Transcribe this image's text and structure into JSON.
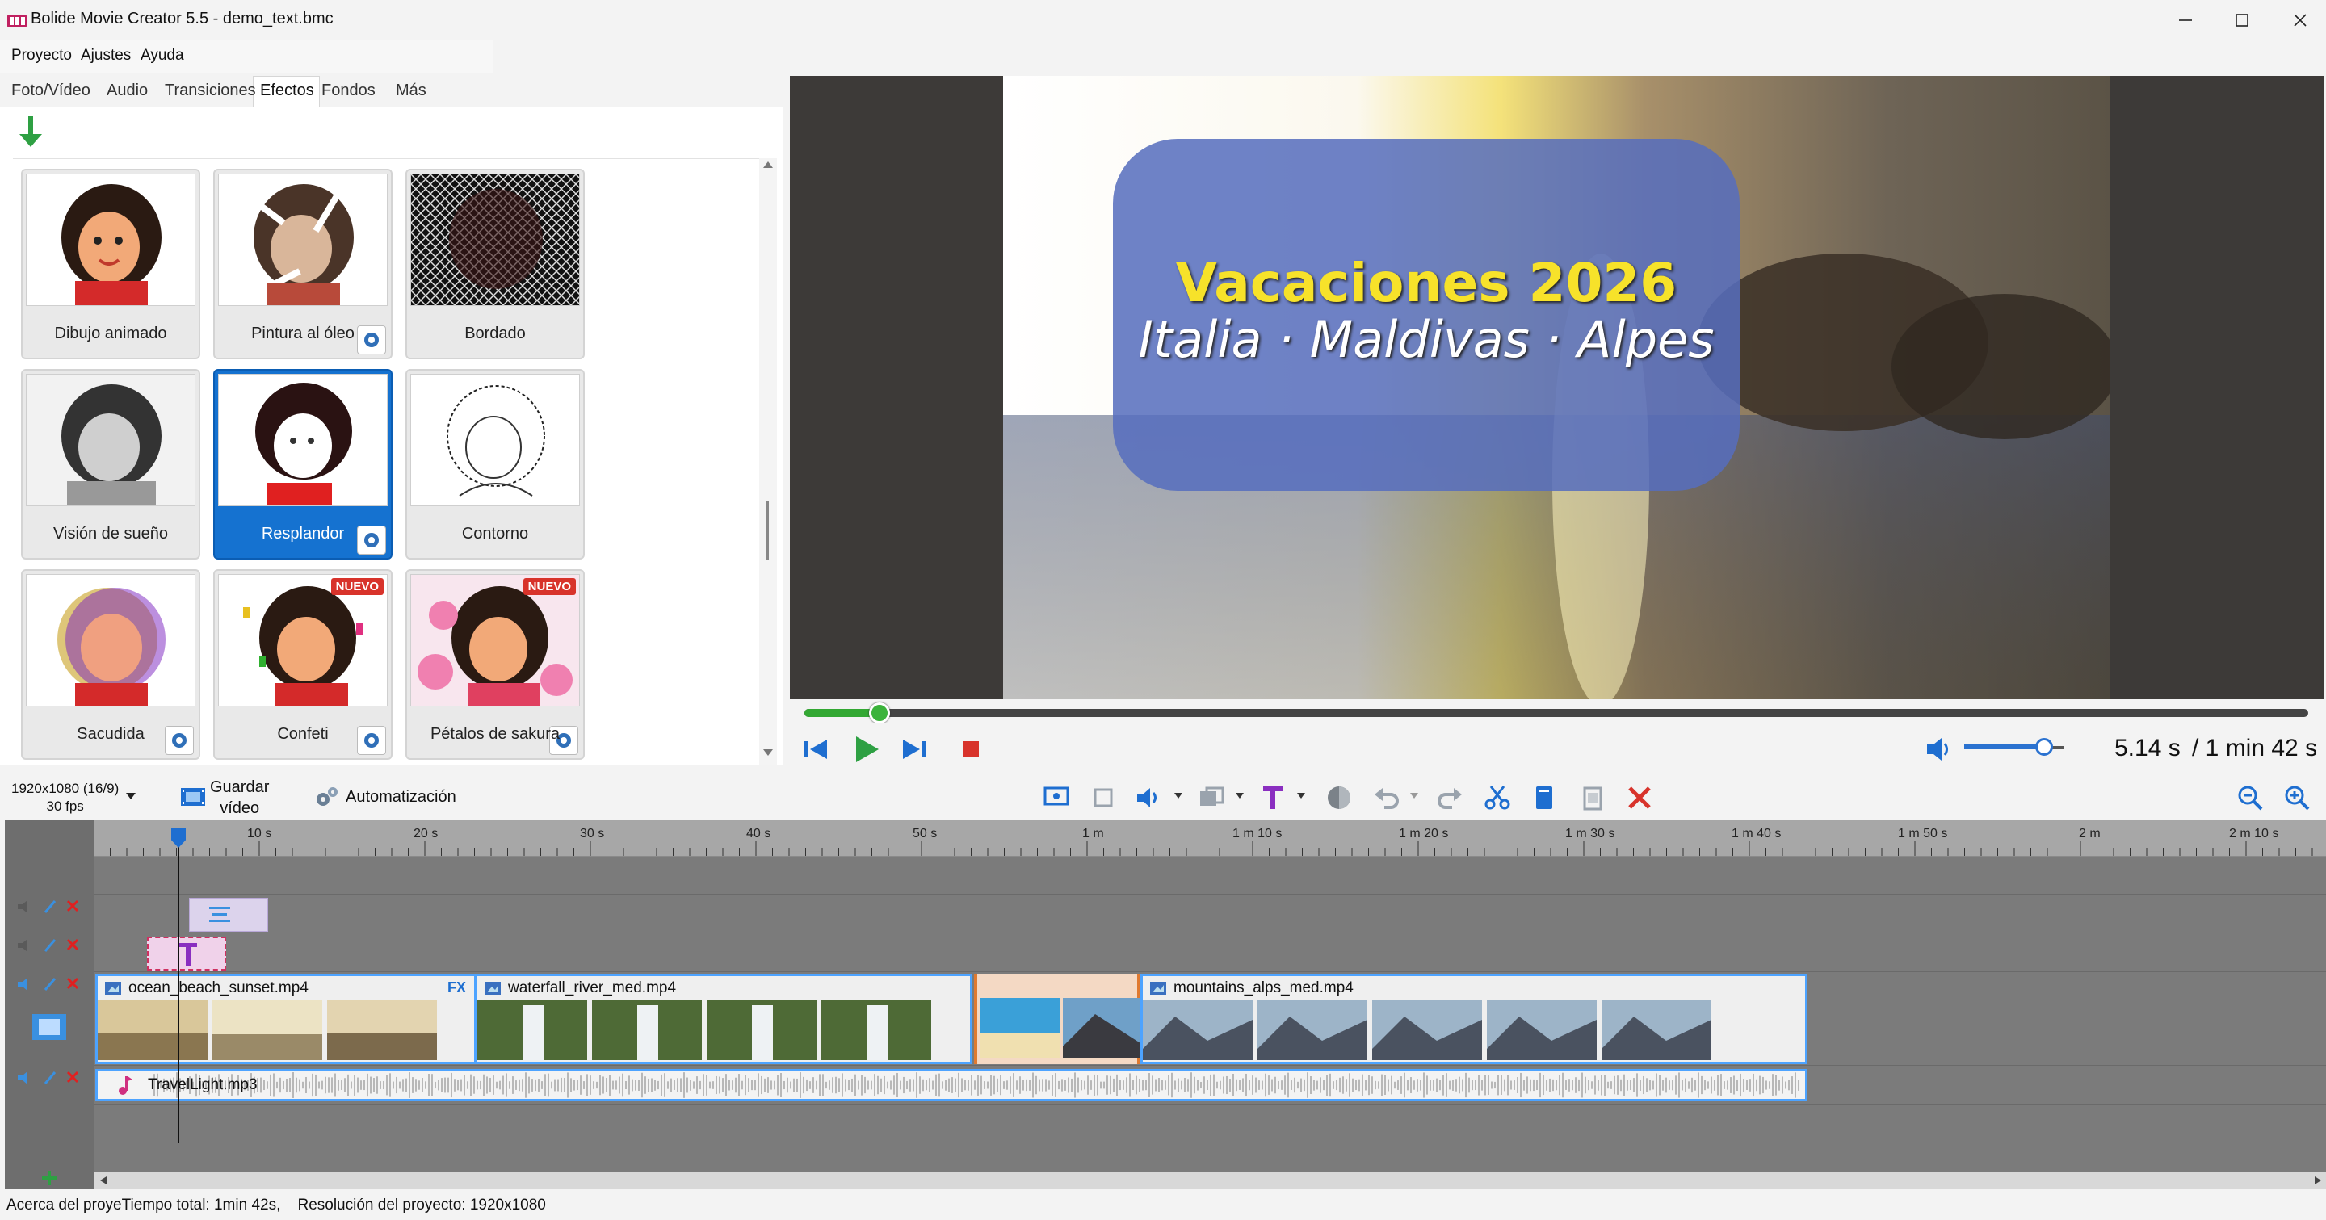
{
  "window": {
    "title": "Bolide Movie Creator 5.5 - demo_text.bmc",
    "controls": [
      "minimize",
      "maximize",
      "close"
    ]
  },
  "menu": [
    "Proyecto",
    "Ajustes",
    "Ayuda"
  ],
  "tabs": [
    "Foto/Vídeo",
    "Audio",
    "Transiciones",
    "Efectos",
    "Fondos",
    "Más"
  ],
  "active_tab": "Efectos",
  "effects": [
    {
      "label": "Dibujo animado",
      "gear": false,
      "new": false
    },
    {
      "label": "Pintura al óleo",
      "gear": true,
      "new": false
    },
    {
      "label": "Bordado",
      "gear": false,
      "new": false
    },
    {
      "label": "Visión de sueño",
      "gear": false,
      "new": false
    },
    {
      "label": "Resplandor",
      "gear": true,
      "new": false,
      "selected": true
    },
    {
      "label": "Contorno",
      "gear": false,
      "new": false
    },
    {
      "label": "Sacudida",
      "gear": true,
      "new": false
    },
    {
      "label": "Confeti",
      "gear": true,
      "new": true
    },
    {
      "label": "Pétalos de sakura",
      "gear": true,
      "new": true
    }
  ],
  "new_badge": "NUEVO",
  "preview": {
    "title_line1": "Vacaciones 2026",
    "title_line2": "Italia · Maldivas · Alpes",
    "progress": 0.05
  },
  "transport": {
    "time_current": "5.14 s",
    "time_total": "/ 1 min 42 s",
    "volume": 0.8
  },
  "toolbar": {
    "resolution_line1": "1920x1080 (16/9)",
    "resolution_line2": "30 fps",
    "save_video_line1": "Guardar",
    "save_video_line2": "vídeo",
    "automation": "Automatización"
  },
  "timeline": {
    "ruler_labels": [
      "10 s",
      "20 s",
      "30 s",
      "40 s",
      "50 s",
      "1 m",
      "1 m 10 s",
      "1 m 20 s",
      "1 m 30 s",
      "1 m 40 s",
      "1 m 50 s",
      "2 m",
      "2 m 10 s"
    ],
    "clips": {
      "ocean": "ocean_beach_sunset.mp4",
      "waterfall": "waterfall_river_med.mp4",
      "mountains": "mountains_alps_med.mp4",
      "audio": "TravelLight.mp3",
      "fx_label": "FX"
    }
  },
  "status": {
    "about": "Acerca del proye",
    "total_time": "Tiempo total: 1min 42s,",
    "resolution": "Resolución del proyecto:   1920x1080"
  },
  "colors": {
    "selection_blue": "#1572d0",
    "play_green": "#2ea043",
    "stop_red": "#d8332b",
    "title_yellow": "#f7e22a"
  }
}
